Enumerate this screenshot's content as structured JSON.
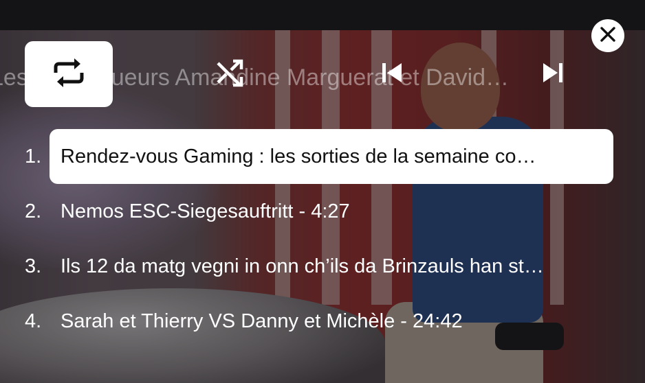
{
  "player": {
    "now_playing_title": "Les chroniqueurs Amandine Marguerat et David…",
    "controls": {
      "repeat_icon": "repeat-icon",
      "shuffle_icon": "shuffle-icon",
      "previous_icon": "skip-previous-icon",
      "next_icon": "skip-next-icon",
      "close_icon": "close-icon"
    },
    "colors": {
      "active_item_bg": "#ffffff",
      "active_item_text": "#111111",
      "text": "#ffffff"
    }
  },
  "playlist": {
    "tracks": [
      {
        "number": "1.",
        "title": "Rendez-vous Gaming : les sorties de la semaine co…",
        "active": true
      },
      {
        "number": "2.",
        "title": "Nemos ESC-Siegesauftritt - 4:27",
        "active": false
      },
      {
        "number": "3.",
        "title": "Ils 12 da matg vegni in onn ch’ils da Brinzauls han st…",
        "active": false
      },
      {
        "number": "4.",
        "title": "Sarah et Thierry VS Danny et Michèle - 24:42",
        "active": false
      }
    ]
  }
}
